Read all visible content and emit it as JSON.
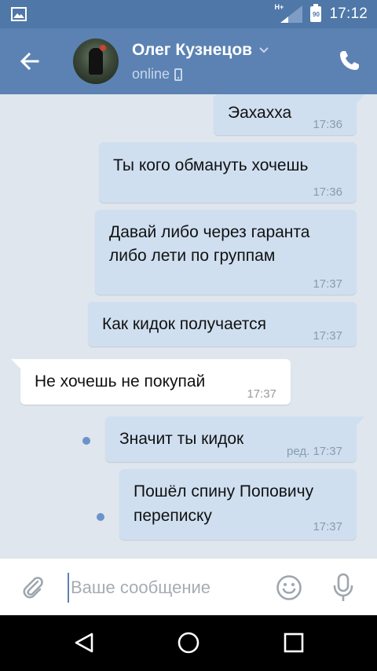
{
  "status_bar": {
    "time": "17:12",
    "battery": "90",
    "network": "H+",
    "icons": [
      "image-icon",
      "signal-icon",
      "battery-icon"
    ]
  },
  "header": {
    "contact_name": "Олег Кузнецов",
    "status": "online",
    "icons": [
      "back-arrow-icon",
      "chevron-down-icon",
      "mobile-device-icon",
      "phone-icon"
    ]
  },
  "messages": [
    {
      "text": "Эахахха",
      "time": "17:36",
      "direction": "out"
    },
    {
      "text": "Ты кого обмануть хочешь",
      "time": "17:36",
      "direction": "out"
    },
    {
      "lines": [
        "Давай либо через гаранта",
        "либо лети по группам"
      ],
      "time": "17:37",
      "direction": "out"
    },
    {
      "text": "Как кидок получается",
      "time": "17:37",
      "direction": "out"
    },
    {
      "text": "Не хочешь не покупай",
      "time": "17:37",
      "direction": "in"
    },
    {
      "text": "Значит ты кидок",
      "time": "ред. 17:37",
      "direction": "out",
      "unread": true
    },
    {
      "lines": [
        "Пошёл спину Поповичу",
        "переписку"
      ],
      "time": "17:37",
      "direction": "out",
      "unread": true
    }
  ],
  "composer": {
    "placeholder": "Ваше сообщение",
    "value": "",
    "icons": [
      "paperclip-icon",
      "emoji-icon",
      "microphone-icon"
    ]
  },
  "nav_bar": {
    "icons": [
      "nav-back-icon",
      "nav-home-icon",
      "nav-recents-icon"
    ]
  },
  "colors": {
    "header": "#5b82b3",
    "status_bar": "#4f77a8",
    "chat_background": "#dfe6ee",
    "outgoing_bubble": "#cfdff0",
    "incoming_bubble": "#ffffff"
  }
}
